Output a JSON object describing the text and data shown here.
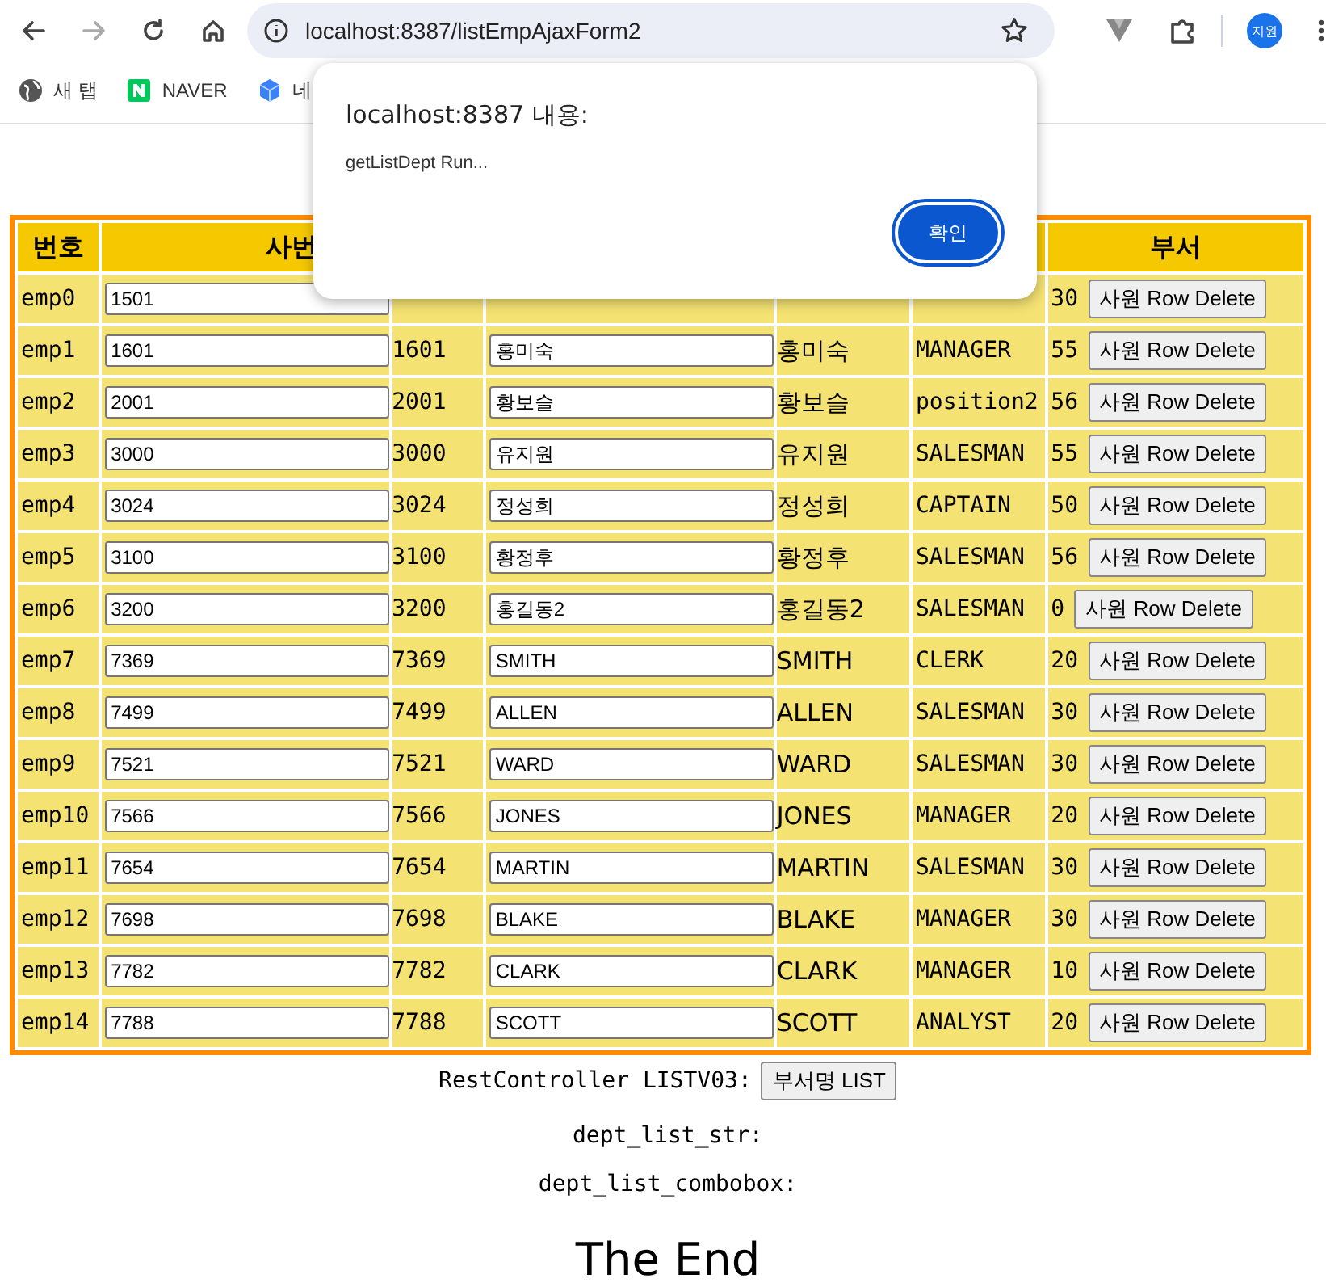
{
  "browser": {
    "url": "localhost:8387/listEmpAjaxForm2",
    "profile": "지원",
    "bookmarks": [
      {
        "label": "새 탭",
        "kind": "globe"
      },
      {
        "label": "NAVER",
        "kind": "naver"
      },
      {
        "label": "네",
        "kind": "cube"
      }
    ]
  },
  "dialog": {
    "title": "localhost:8387 내용:",
    "message": "getListDept Run...",
    "button": "확인"
  },
  "table": {
    "headers": {
      "no": "번호",
      "empno": "사번",
      "dept": "부서"
    },
    "rows": [
      {
        "id": "emp0",
        "empno_input": "1501",
        "deptno": "30",
        "button": "사원 Row Delete"
      },
      {
        "id": "emp1",
        "empno_input": "1601",
        "empno": "1601",
        "name_input": "홍미숙",
        "name": "홍미숙",
        "job": "MANAGER",
        "deptno": "55",
        "button": "사원 Row Delete"
      },
      {
        "id": "emp2",
        "empno_input": "2001",
        "empno": "2001",
        "name_input": "황보슬",
        "name": "황보슬",
        "job": "position2",
        "deptno": "56",
        "button": "사원 Row Delete"
      },
      {
        "id": "emp3",
        "empno_input": "3000",
        "empno": "3000",
        "name_input": "유지원",
        "name": "유지원",
        "job": "SALESMAN",
        "deptno": "55",
        "button": "사원 Row Delete"
      },
      {
        "id": "emp4",
        "empno_input": "3024",
        "empno": "3024",
        "name_input": "정성희",
        "name": "정성희",
        "job": "CAPTAIN",
        "deptno": "50",
        "button": "사원 Row Delete"
      },
      {
        "id": "emp5",
        "empno_input": "3100",
        "empno": "3100",
        "name_input": "황정후",
        "name": "황정후",
        "job": "SALESMAN",
        "deptno": "56",
        "button": "사원 Row Delete"
      },
      {
        "id": "emp6",
        "empno_input": "3200",
        "empno": "3200",
        "name_input": "홍길동2",
        "name": "홍길동2",
        "job": "SALESMAN",
        "deptno": "0",
        "button": "사원 Row Delete"
      },
      {
        "id": "emp7",
        "empno_input": "7369",
        "empno": "7369",
        "name_input": "SMITH",
        "name": "SMITH",
        "job": "CLERK",
        "deptno": "20",
        "button": "사원 Row Delete"
      },
      {
        "id": "emp8",
        "empno_input": "7499",
        "empno": "7499",
        "name_input": "ALLEN",
        "name": "ALLEN",
        "job": "SALESMAN",
        "deptno": "30",
        "button": "사원 Row Delete"
      },
      {
        "id": "emp9",
        "empno_input": "7521",
        "empno": "7521",
        "name_input": "WARD",
        "name": "WARD",
        "job": "SALESMAN",
        "deptno": "30",
        "button": "사원 Row Delete"
      },
      {
        "id": "emp10",
        "empno_input": "7566",
        "empno": "7566",
        "name_input": "JONES",
        "name": "JONES",
        "job": "MANAGER",
        "deptno": "20",
        "button": "사원 Row Delete"
      },
      {
        "id": "emp11",
        "empno_input": "7654",
        "empno": "7654",
        "name_input": "MARTIN",
        "name": "MARTIN",
        "job": "SALESMAN",
        "deptno": "30",
        "button": "사원 Row Delete"
      },
      {
        "id": "emp12",
        "empno_input": "7698",
        "empno": "7698",
        "name_input": "BLAKE",
        "name": "BLAKE",
        "job": "MANAGER",
        "deptno": "30",
        "button": "사원 Row Delete"
      },
      {
        "id": "emp13",
        "empno_input": "7782",
        "empno": "7782",
        "name_input": "CLARK",
        "name": "CLARK",
        "job": "MANAGER",
        "deptno": "10",
        "button": "사원 Row Delete"
      },
      {
        "id": "emp14",
        "empno_input": "7788",
        "empno": "7788",
        "name_input": "SCOTT",
        "name": "SCOTT",
        "job": "ANALYST",
        "deptno": "20",
        "button": "사원 Row Delete"
      }
    ]
  },
  "footer": {
    "rest_label": "RestController LISTV03:",
    "rest_button": "부서명 LIST",
    "lines": [
      "dept_list_str:",
      "dept_list_combobox:"
    ],
    "heading": "The End"
  }
}
